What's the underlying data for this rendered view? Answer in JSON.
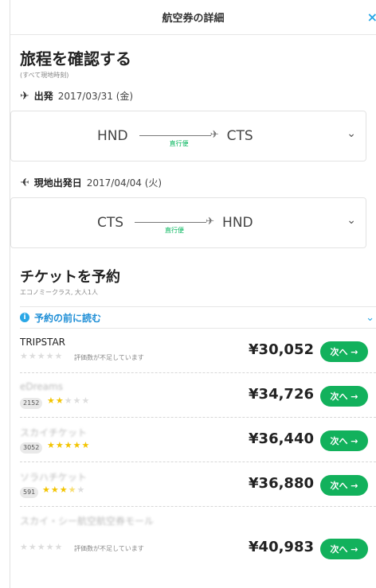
{
  "header": {
    "title": "航空券の詳細",
    "close_icon": "×"
  },
  "itinerary": {
    "title": "旅程を確認する",
    "note": "(すべて現地時刻)",
    "outbound": {
      "label": "出発",
      "date": "2017/03/31 (金)",
      "from": "HND",
      "to": "CTS",
      "type": "直行便"
    },
    "return": {
      "label": "現地出発日",
      "date": "2017/04/04 (火)",
      "from": "CTS",
      "to": "HND",
      "type": "直行便"
    }
  },
  "booking": {
    "title": "チケットを予約",
    "subtitle": "エコノミークラス, 大人1人",
    "read_first": "予約の前に読む",
    "button_label": "次へ →",
    "providers": [
      {
        "name": "TRIPSTAR",
        "review_count": "",
        "stars": 0,
        "note": "評価数が不足しています",
        "price": "¥30,052"
      },
      {
        "name": "eDreams",
        "review_count": "2152",
        "stars": 2,
        "note": "",
        "price": "¥34,726"
      },
      {
        "name": "スカイチケット",
        "review_count": "3052",
        "stars": 5,
        "note": "",
        "price": "¥36,440"
      },
      {
        "name": "ソラハチケット",
        "review_count": "591",
        "stars": 3.5,
        "note": "",
        "price": "¥36,880"
      },
      {
        "name": "スカイ・シー航空航空券モール",
        "review_count": "",
        "stars": 0,
        "note": "評価数が不足しています",
        "price": "¥40,983"
      }
    ]
  },
  "colors": {
    "accent": "#2aa7e6",
    "cta": "#12b15c",
    "star": "#f3c400",
    "direct": "#00b45a"
  }
}
